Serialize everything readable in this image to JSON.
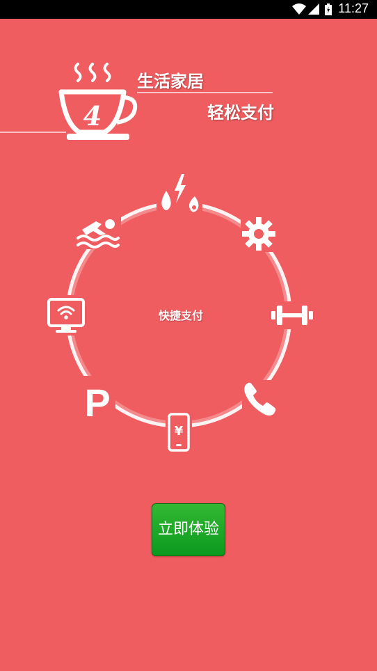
{
  "status_bar": {
    "time": "11:27"
  },
  "logo": {
    "number": "4"
  },
  "header": {
    "line1": "生活家居",
    "line2": "轻松支付"
  },
  "circle": {
    "center_label": "快捷支付",
    "icons": [
      "utilities-icon",
      "settings-icon",
      "fitness-icon",
      "phone-icon",
      "mobile-payment-icon",
      "parking-icon",
      "tv-wifi-icon",
      "swimming-icon"
    ]
  },
  "cta": {
    "label": "立即体验"
  },
  "colors": {
    "background": "#F05D60",
    "button": "#16A22A",
    "text": "#FFFFFF"
  }
}
